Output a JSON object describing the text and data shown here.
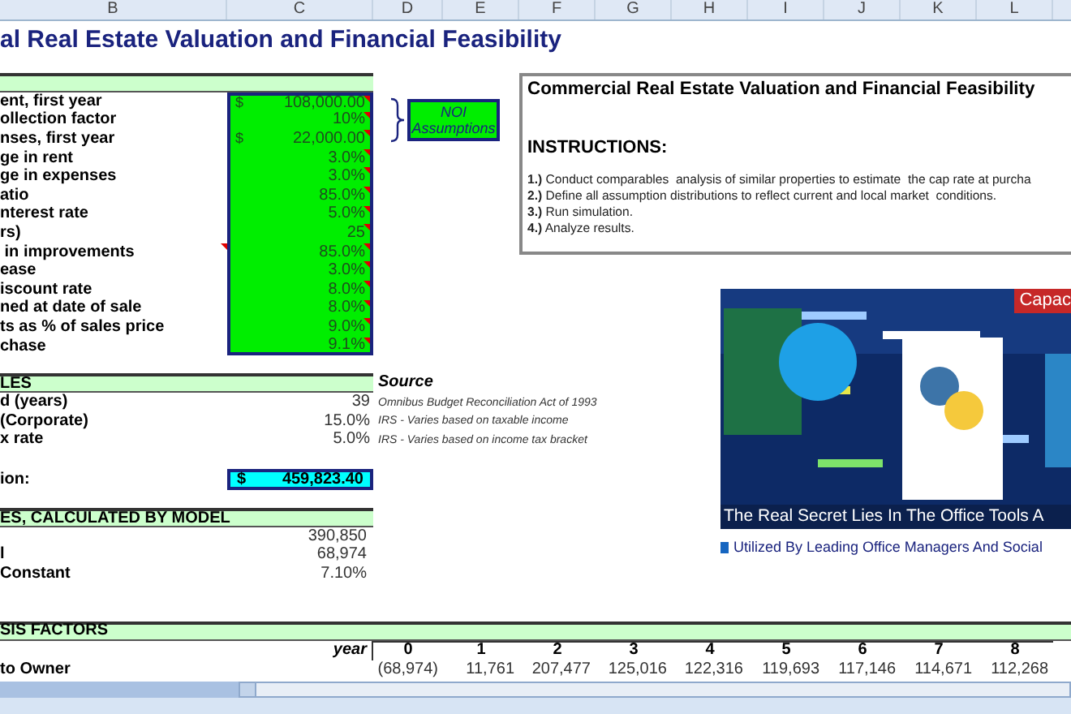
{
  "column_headers": [
    "B",
    "C",
    "D",
    "E",
    "F",
    "G",
    "H",
    "I",
    "J",
    "K",
    "L"
  ],
  "title": "al Real Estate Valuation and Financial Feasibility",
  "inputs": [
    {
      "label": "ent, first year",
      "prefix": "$",
      "value": "108,000.00",
      "label_comment": false
    },
    {
      "label": "ollection factor",
      "value": "10%",
      "label_comment": false
    },
    {
      "label": "nses, first year",
      "prefix": "$",
      "value": "22,000.00",
      "label_comment": false
    },
    {
      "label": "ge in rent",
      "value": "3.0%",
      "label_comment": false
    },
    {
      "label": "ge in expenses",
      "value": "3.0%",
      "label_comment": false
    },
    {
      "label": "atio",
      "value": "85.0%",
      "label_comment": false
    },
    {
      "label": "nterest rate",
      "value": "5.0%",
      "label_comment": false
    },
    {
      "label": "rs)",
      "value": "25",
      "label_comment": false
    },
    {
      "label": " in improvements",
      "value": "85.0%",
      "label_comment": true
    },
    {
      "label": "ease",
      "value": "3.0%",
      "label_comment": false
    },
    {
      "label": "iscount rate",
      "value": "8.0%",
      "label_comment": false
    },
    {
      "label": "ned at date of sale",
      "value": "8.0%",
      "label_comment": false
    },
    {
      "label": "ts as % of sales price",
      "value": "9.0%",
      "label_comment": false
    },
    {
      "label": "chase",
      "value": "9.1%",
      "label_comment": false
    }
  ],
  "noi_note": "NOI Assumptions",
  "tax": {
    "header": "LES",
    "source_heading": "Source",
    "rows": [
      {
        "label": "d (years)",
        "value": "39",
        "source": "Omnibus Budget Reconciliation Act of 1993"
      },
      {
        "label": "(Corporate)",
        "value": "15.0%",
        "source": "IRS - Varies based on taxable income"
      },
      {
        "label": "x rate",
        "value": "5.0%",
        "source": "IRS - Varies based on income tax bracket"
      }
    ]
  },
  "valuation": {
    "label": "ion:",
    "prefix": "$",
    "value": "459,823.40"
  },
  "model": {
    "header": "ES, CALCULATED BY MODEL",
    "rows": [
      {
        "value": "390,850"
      },
      {
        "label": "l",
        "value": "68,974"
      },
      {
        "label": "Constant",
        "value": "7.10%"
      }
    ]
  },
  "analysis": {
    "header": "SIS FACTORS",
    "year_label": "year",
    "years": [
      "0",
      "1",
      "2",
      "3",
      "4",
      "5",
      "6",
      "7",
      "8"
    ],
    "rows": [
      {
        "label": "to Owner",
        "values": [
          "(68,974)",
          "11,761",
          "207,477",
          "125,016",
          "122,316",
          "119,693",
          "117,146",
          "114,671",
          "112,268"
        ]
      }
    ]
  },
  "instructions": {
    "title": "Commercial Real Estate Valuation and Financial Feasibility",
    "heading": "INSTRUCTIONS:",
    "steps": [
      {
        "number": "1.)",
        "text": "Conduct comparables  analysis of similar properties to estimate  the cap rate at purcha"
      },
      {
        "number": "2.)",
        "text": "Define all assumption distributions to reflect current and local market  conditions."
      },
      {
        "number": "3.)",
        "text": "Run simulation."
      },
      {
        "number": "4.)",
        "text": "Analyze results."
      }
    ]
  },
  "ad": {
    "kind": "picture",
    "badge": "Capac",
    "caption": "The Real Secret Lies In The Office Tools A",
    "tagline": "Utilized By Leading Office Managers And Social"
  }
}
